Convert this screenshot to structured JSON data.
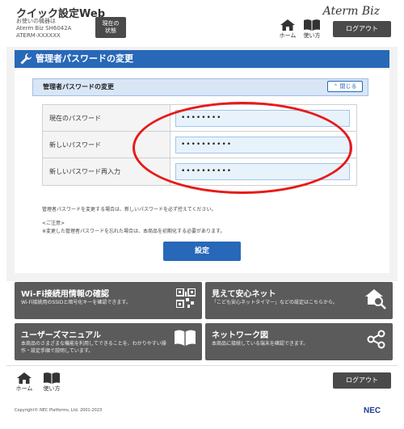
{
  "header": {
    "app_title": "クイック設定Web",
    "device_line1": "お使いの機器は",
    "device_line2": "Aterm Biz SH6042A",
    "device_line3": "ATERM-XXXXXX",
    "status_line1": "現在の",
    "status_line2": "状態",
    "brand": "Aterm Biz",
    "home_label": "ホーム",
    "manual_label": "使い方",
    "logout_label": "ログアウト"
  },
  "section": {
    "title": "管理者パスワードの変更"
  },
  "subsection": {
    "title": "管理者パスワードの変更",
    "close_label": "閉じる"
  },
  "form": {
    "rows": [
      {
        "label": "現在のパスワード",
        "value": "••••••••"
      },
      {
        "label": "新しいパスワード",
        "value": "••••••••••"
      },
      {
        "label": "新しいパスワード再入力",
        "value": "••••••••••"
      }
    ]
  },
  "notes": {
    "line1": "管理者パスワードを変更する場合は、新しいパスワードを必ず控えてください。",
    "line2": "<ご注意>",
    "line3": "※変更した管理者パスワードを忘れた場合は、本商品を初期化する必要があります。"
  },
  "set_button": "設定",
  "tiles": [
    {
      "title": "Wi-Fi接続用情報の確認",
      "desc": "Wi-Fi接続用のSSIDと暗号化キーを確認できます。"
    },
    {
      "title": "見えて安心ネット",
      "desc": "「こども安心ネットタイマー」などの設定はこちらから。"
    },
    {
      "title": "ユーザーズマニュアル",
      "desc": "本商品のさまざまな機能を利用してできることを、わかりやすい操作・設定手順で説明しています。"
    },
    {
      "title": "ネットワーク図",
      "desc": "本商品に接続している端末を確認できます。"
    }
  ],
  "footer": {
    "home_label": "ホーム",
    "manual_label": "使い方",
    "logout_label": "ログアウト",
    "copyright": "Copyright© NEC Platforms, Ltd. 2001-2023",
    "nec": "NEC"
  },
  "colors": {
    "primary_blue": "#2868b8",
    "dark_gray": "#4a4a4a",
    "tile_gray": "#5b5b5b",
    "annotation_red": "#e81a1a"
  }
}
